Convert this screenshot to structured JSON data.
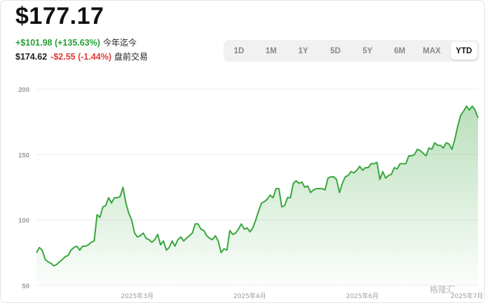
{
  "quote": {
    "price": "$177.17",
    "ytd_change": "+$101.98 (+135.63%)",
    "ytd_label": "今年迄今",
    "premarket_price": "$174.62",
    "premarket_change": "-$2.55 (-1.44%)",
    "premarket_label": "盘前交易"
  },
  "ranges": [
    "1D",
    "1M",
    "1Y",
    "5D",
    "5Y",
    "6M",
    "MAX",
    "YTD"
  ],
  "selected_range": "YTD",
  "colors": {
    "line": "#3aa63f",
    "up": "#26a035",
    "down": "#e23a3a"
  },
  "watermark": "格隆汇",
  "chart_data": {
    "type": "area",
    "y_ticks": [
      200,
      150,
      100,
      50
    ],
    "ylim": [
      50,
      200
    ],
    "x_ticks": [
      {
        "label": "2025年3月",
        "pos": 0.228
      },
      {
        "label": "2025年4月",
        "pos": 0.483
      },
      {
        "label": "2025年6月",
        "pos": 0.738
      },
      {
        "label": "2025年7月",
        "pos": 0.975
      }
    ],
    "grid": true,
    "values": [
      75,
      79,
      77,
      70,
      68,
      67,
      65,
      66,
      68,
      70,
      72,
      73,
      77,
      79,
      80,
      77,
      80,
      80,
      81,
      83,
      84,
      104,
      102,
      110,
      111,
      117,
      113,
      117,
      117,
      118,
      125,
      113,
      105,
      100,
      90,
      87,
      88,
      90,
      86,
      85,
      83,
      85,
      89,
      81,
      84,
      77,
      79,
      84,
      80,
      85,
      87,
      84,
      86,
      88,
      90,
      97,
      97,
      93,
      92,
      88,
      86,
      85,
      88,
      84,
      75,
      78,
      77,
      92,
      89,
      90,
      93,
      97,
      93,
      94,
      91,
      94,
      100,
      107,
      113,
      114,
      116,
      119,
      117,
      124,
      124,
      110,
      111,
      117,
      117,
      128,
      130,
      128,
      129,
      125,
      126,
      121,
      123,
      124,
      124,
      124,
      123,
      132,
      133,
      133,
      131,
      121,
      128,
      133,
      134,
      137,
      136,
      138,
      141,
      138,
      140,
      140,
      143,
      143,
      144,
      131,
      137,
      132,
      134,
      135,
      140,
      139,
      143,
      143,
      143,
      149,
      149,
      150,
      154,
      153,
      151,
      149,
      155,
      154,
      159,
      157,
      157,
      155,
      159,
      158,
      154,
      162,
      172,
      180,
      183,
      187,
      184,
      187,
      184,
      178
    ]
  }
}
